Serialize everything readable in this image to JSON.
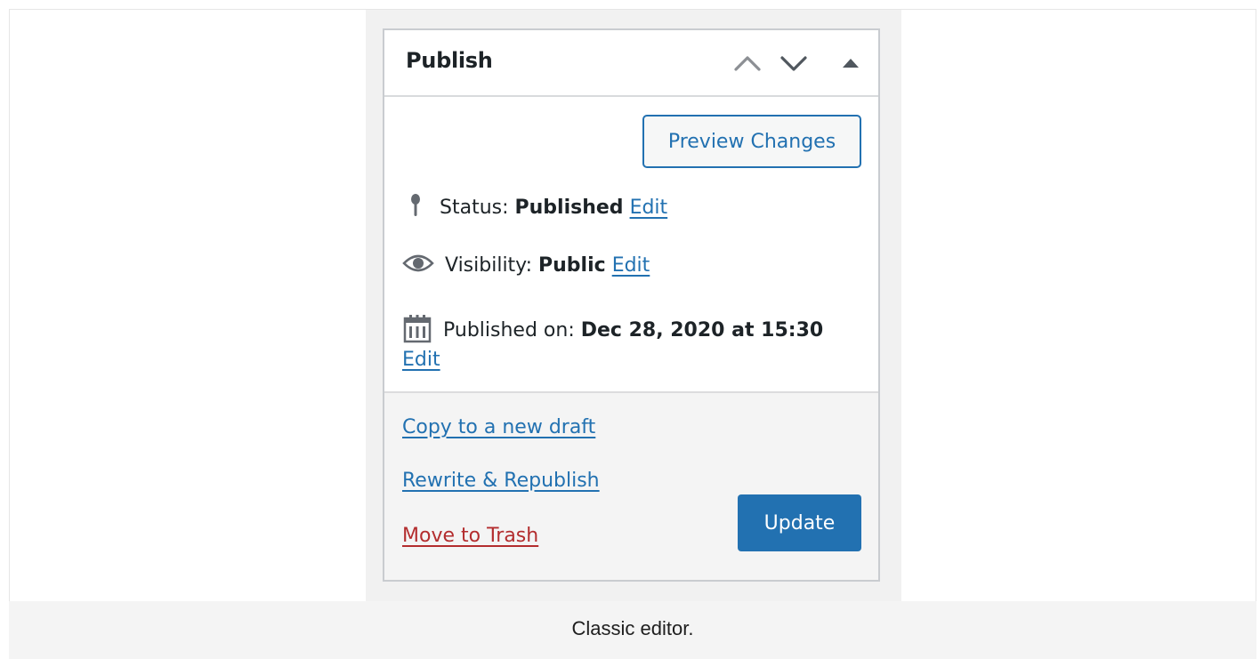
{
  "publish_box": {
    "title": "Publish",
    "header_controls": {
      "move_up_icon": "chevron-up-icon",
      "move_down_icon": "chevron-down-icon",
      "toggle_icon": "triangle-up-icon"
    },
    "preview_button": "Preview Changes",
    "status": {
      "label": "Status:",
      "value": "Published",
      "edit": "Edit",
      "icon": "pin-icon"
    },
    "visibility": {
      "label": "Visibility:",
      "value": "Public",
      "edit": "Edit",
      "icon": "eye-icon"
    },
    "published_on": {
      "label": "Published on:",
      "value": "Dec 28, 2020 at 15:30",
      "edit": "Edit",
      "icon": "calendar-icon"
    },
    "footer": {
      "copy_draft": "Copy to a new draft",
      "rewrite_republish": "Rewrite & Republish",
      "move_to_trash": "Move to Trash",
      "update_button": "Update"
    }
  },
  "caption": "Classic editor.",
  "colors": {
    "link": "#2271b1",
    "primary_button": "#2271b1",
    "trash_link": "#b32d2e",
    "text": "#1d2327",
    "panel_background": "#f1f1f1"
  }
}
